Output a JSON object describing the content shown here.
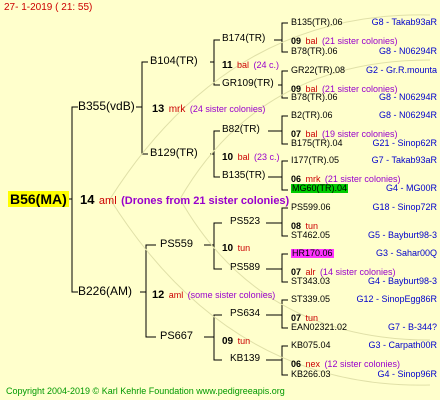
{
  "header": {
    "date": "27-  1-2019 ( 21: 55)"
  },
  "root": {
    "name": "B56(MA)"
  },
  "gen1": {
    "year": "14",
    "breeder": "aml",
    "sisters": "(Drones from 21 sister colonies)",
    "father": "B355(vdB)",
    "mother": "B226(AM)"
  },
  "gen2": {
    "f": {
      "year": "13",
      "breeder": "mrk",
      "sisters": "(24 sister colonies)",
      "father": "B104(TR)",
      "mother": "B129(TR)"
    },
    "m": {
      "year": "12",
      "breeder": "aml",
      "sisters": "(some sister colonies)",
      "father": "PS559",
      "mother": "PS667"
    }
  },
  "gen3": {
    "ff": {
      "year": "11",
      "breeder": "bal",
      "sisters": "(24 c.)",
      "father": "B174(TR)",
      "mother": "GR109(TR)"
    },
    "fm": {
      "year": "10",
      "breeder": "bal",
      "sisters": "(23 c.)",
      "father": "B82(TR)",
      "mother": "B135(TR)"
    },
    "mf": {
      "year": "10",
      "breeder": "tun",
      "sisters": "",
      "father": "PS523",
      "mother": "PS589"
    },
    "mm": {
      "year": "09",
      "breeder": "tun",
      "sisters": "",
      "father": "PS634",
      "mother": "KB139"
    }
  },
  "gen4": {
    "fff": {
      "year": "09",
      "breeder": "bal",
      "sisters": "(21 sister colonies)",
      "father": "B135(TR).06",
      "father_breed": "G8 - Takab93aR",
      "mother": "B78(TR).06",
      "mother_breed": "G8 - N06294R"
    },
    "ffm": {
      "year": "09",
      "breeder": "bal",
      "sisters": "(21 sister colonies)",
      "father": "GR22(TR).08",
      "father_breed": "G2 - Gr.R.mounta",
      "mother": "B78(TR).06",
      "mother_breed": "G8 - N06294R"
    },
    "fmf": {
      "year": "07",
      "breeder": "bal",
      "sisters": "(19 sister colonies)",
      "father": "B2(TR).06",
      "father_breed": "G8 - N06294R",
      "mother": "B175(TR).04",
      "mother_breed": "G21 - Sinop62R"
    },
    "fmm": {
      "year": "06",
      "breeder": "mrk",
      "sisters": "(21 sister colonies)",
      "father": "I177(TR).05",
      "father_breed": "G7 - Takab93aR",
      "mother": "MG60(TR).04",
      "mother_breed": "G4 - MG00R"
    },
    "mff": {
      "year": "08",
      "breeder": "tun",
      "sisters": "",
      "father": "PS599.06",
      "father_breed": "G18 - Sinop72R",
      "mother": "ST462.05",
      "mother_breed": "G5 - Bayburt98-3"
    },
    "mfm": {
      "year": "07",
      "breeder": "alr",
      "sisters": "(14 sister colonies)",
      "father": "HR170.06",
      "father_breed": "G3 - Sahar00Q",
      "mother": "ST343.03",
      "mother_breed": "G4 - Bayburt98-3"
    },
    "mmf": {
      "year": "07",
      "breeder": "tun",
      "sisters": "",
      "father": "ST339.05",
      "father_breed": "G12 - SinopEgg86R",
      "mother": "EAN02321.02",
      "mother_breed": "G7 - B-344?"
    },
    "mmm": {
      "year": "06",
      "breeder": "nex",
      "sisters": "(12 sister colonies)",
      "father": "KB075.04",
      "father_breed": "G3 - Carpath00R",
      "mother": "KB266.03",
      "mother_breed": "G4 - Sinop96R"
    }
  },
  "footer": {
    "copyright": "Copyright 2004-2019 © Karl Kehrle Foundation    www.pedigreeapis.org"
  }
}
